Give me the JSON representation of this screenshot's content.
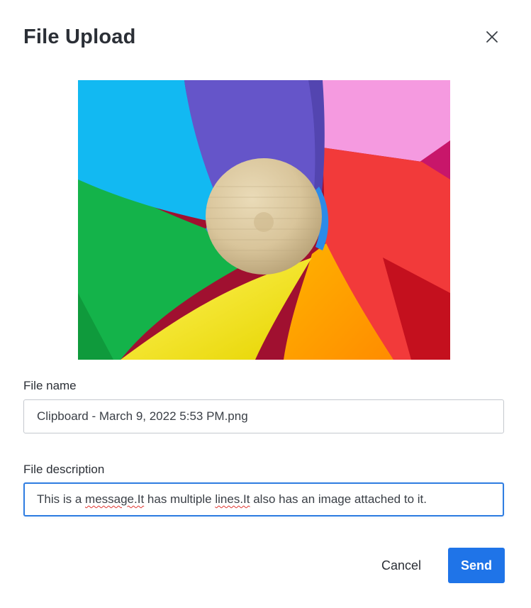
{
  "dialog": {
    "title": "File Upload",
    "close_icon": "close-icon"
  },
  "preview": {
    "image_description": "rainbow-pinwheel-photo"
  },
  "file_name": {
    "label": "File name",
    "value": "Clipboard - March 9, 2022 5:53 PM.png"
  },
  "file_description": {
    "label": "File description",
    "value_parts": {
      "p1": "This is a ",
      "p2": "message.It",
      "p3": " has multiple ",
      "p4": "lines.It",
      "p5": " also has an image attached to it."
    }
  },
  "actions": {
    "cancel_label": "Cancel",
    "send_label": "Send"
  },
  "colors": {
    "accent": "#1f74e8",
    "focus_border": "#2f7de1",
    "spellcheck": "#e0342f"
  }
}
